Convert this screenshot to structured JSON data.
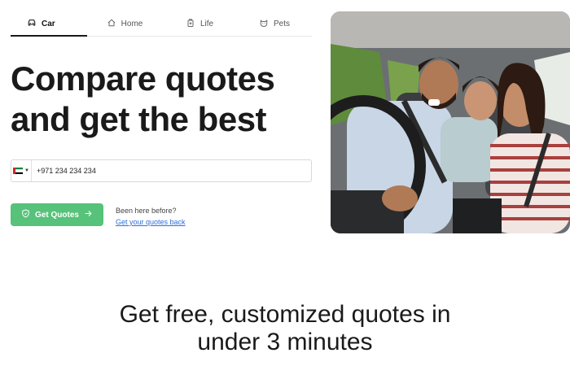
{
  "tabs": [
    {
      "label": "Car",
      "icon": "car-icon",
      "active": true
    },
    {
      "label": "Home",
      "icon": "home-icon",
      "active": false
    },
    {
      "label": "Life",
      "icon": "life-icon",
      "active": false
    },
    {
      "label": "Pets",
      "icon": "pet-icon",
      "active": false
    }
  ],
  "hero": {
    "headline_line1": "Compare quotes",
    "headline_line2": "and get the best"
  },
  "phone": {
    "country_flag": "uae-flag-icon",
    "value": "+971 234 234 234"
  },
  "cta": {
    "label": "Get Quotes",
    "color": "#56c27a"
  },
  "returning": {
    "text": "Been here before?",
    "link": "Get your quotes back"
  },
  "section": {
    "heading_line1": "Get free, customized quotes in",
    "heading_line2": "under 3 minutes"
  },
  "colors": {
    "accent": "#56c27a",
    "link": "#2f6fd6",
    "text": "#1a1a1a"
  }
}
